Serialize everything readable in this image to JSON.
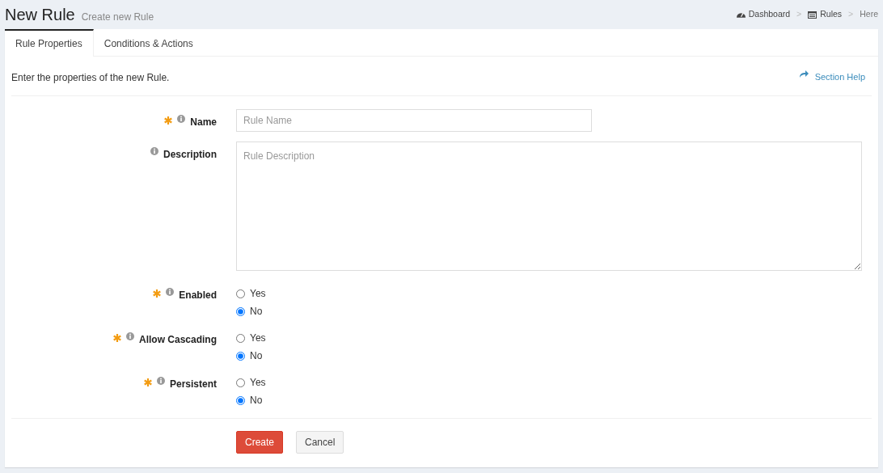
{
  "header": {
    "title": "New Rule",
    "subtitle": "Create new Rule"
  },
  "breadcrumb": [
    {
      "label": "Dashboard",
      "kind": "link"
    },
    {
      "separator": ">",
      "label": "Rules",
      "kind": "link"
    },
    {
      "separator": ">",
      "label": "Here",
      "kind": "current"
    }
  ],
  "tabs": [
    {
      "label": "Rule Properties",
      "selected": true
    },
    {
      "label": "Conditions & Actions",
      "selected": false
    }
  ],
  "intro": "Enter the properties of the new Rule.",
  "section_help": "Section Help",
  "fields": [
    {
      "kind": "text",
      "label": "Name",
      "required": true,
      "placeholder": "Rule Name"
    },
    {
      "kind": "textarea",
      "label": "Description",
      "required": false,
      "placeholder": "Rule Description"
    },
    {
      "kind": "radio",
      "label": "Enabled",
      "required": true,
      "options": [
        {
          "label": "Yes",
          "selected": false
        },
        {
          "label": "No",
          "selected": true
        }
      ]
    },
    {
      "kind": "radio",
      "label": "Allow Cascading",
      "required": true,
      "options": [
        {
          "label": "Yes",
          "selected": false
        },
        {
          "label": "No",
          "selected": true
        }
      ]
    },
    {
      "kind": "radio",
      "label": "Persistent",
      "required": true,
      "options": [
        {
          "label": "Yes",
          "selected": false
        },
        {
          "label": "No",
          "selected": true
        }
      ]
    }
  ],
  "buttons": [
    {
      "label": "Create",
      "kind": "primary"
    },
    {
      "label": "Cancel",
      "kind": "secondary"
    }
  ]
}
